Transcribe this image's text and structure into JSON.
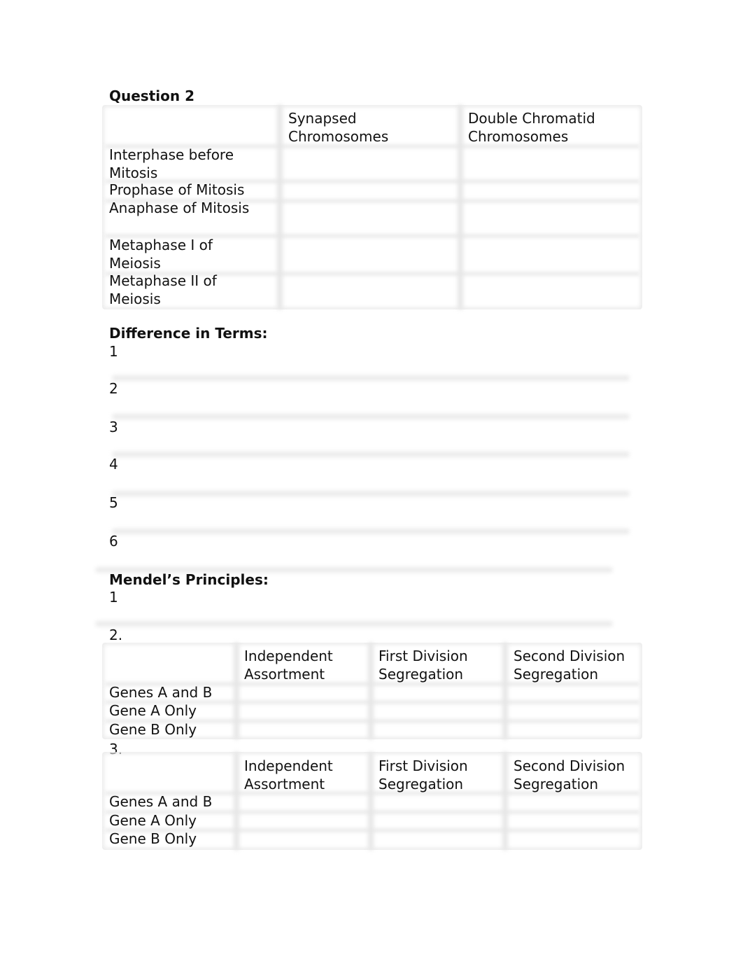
{
  "question2": {
    "title": "Question 2",
    "table": {
      "headers": [
        "",
        "Synapsed\nChromosomes",
        "Double Chromatid\nChromosomes"
      ],
      "rows": [
        "Interphase before\nMitosis",
        "Prophase of Mitosis",
        "Anaphase of Mitosis",
        "Metaphase I of\nMeiosis",
        "Metaphase II of\nMeiosis"
      ]
    }
  },
  "difference": {
    "title": "Difference in Terms:",
    "items": [
      "1",
      "2",
      "3",
      "4",
      "5",
      "6"
    ]
  },
  "mendel": {
    "title": "Mendel’s Principles:",
    "item1": "1",
    "item2": "2.",
    "item3": "3.",
    "table2": {
      "headers": [
        "",
        "Independent\nAssortment",
        "First Division\nSegregation",
        "Second Division\nSegregation"
      ],
      "rows": [
        "Genes A and B",
        "Gene A Only",
        "Gene B Only"
      ]
    },
    "table3": {
      "headers": [
        "",
        "Independent\nAssortment",
        "First Division\nSegregation",
        "Second Division\nSegregation"
      ],
      "rows": [
        "Genes A and B",
        "Gene A Only",
        "Gene B Only"
      ]
    }
  }
}
